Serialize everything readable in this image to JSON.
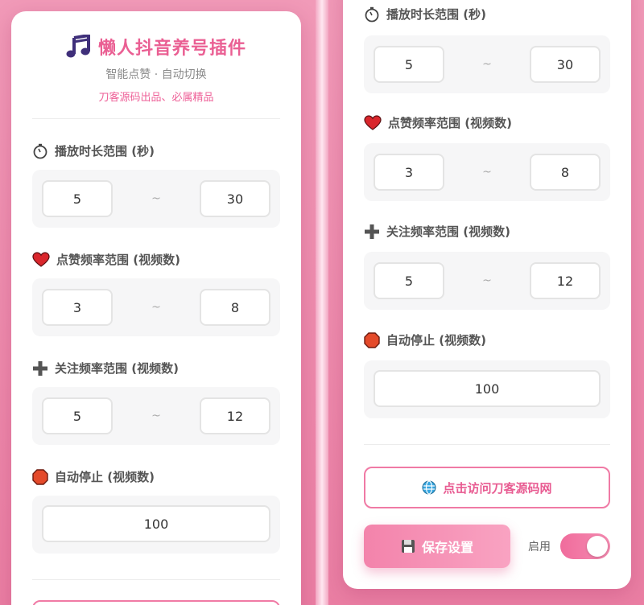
{
  "header": {
    "app_title": "懒人抖音养号插件",
    "subtitle": "智能点赞 · 自动切换",
    "brand_line": "刀客源码出品、必属精品"
  },
  "sections": {
    "play_duration": {
      "label": "播放时长范围 (秒)",
      "icon": "stopwatch-icon",
      "min": "5",
      "max": "30"
    },
    "like_frequency": {
      "label": "点赞频率范围 (视频数)",
      "icon": "heart-icon",
      "min": "3",
      "max": "8"
    },
    "follow_frequency": {
      "label": "关注频率范围 (视频数)",
      "icon": "plus-icon",
      "min": "5",
      "max": "12"
    },
    "auto_stop": {
      "label": "自动停止 (视频数)",
      "icon": "stop-sign-icon",
      "value": "100"
    }
  },
  "range_separator": "~",
  "footer": {
    "visit_label": "点击访问刀客源码网",
    "save_label": "保存设置",
    "toggle_label": "启用",
    "toggle_on": true
  },
  "colors": {
    "accent": "#ea5f93",
    "background": "#ee8aad",
    "heart": "#d9262c",
    "stop": "#e44a2a"
  }
}
